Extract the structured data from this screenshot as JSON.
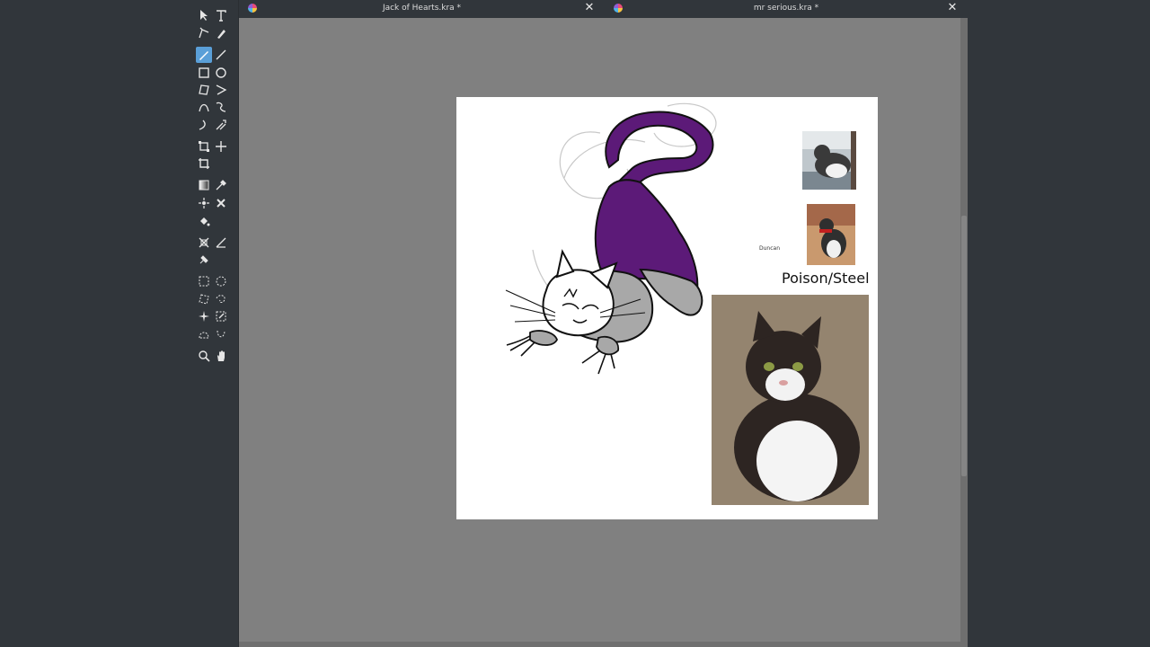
{
  "tabs": [
    {
      "title": "Jack of Hearts.kra *"
    },
    {
      "title": "mr serious.kra *"
    }
  ],
  "toolbox": {
    "tools": [
      {
        "name": "select-shapes-tool-icon",
        "col": 0,
        "row": 0
      },
      {
        "name": "text-tool-icon",
        "col": 1,
        "row": 0
      },
      {
        "name": "edit-shapes-tool-icon",
        "col": 0,
        "row": 1
      },
      {
        "name": "calligraphy-tool-icon",
        "col": 1,
        "row": 1
      },
      {
        "name": "freehand-brush-tool-icon",
        "col": 0,
        "row": 2,
        "active": true
      },
      {
        "name": "line-tool-icon",
        "col": 1,
        "row": 2
      },
      {
        "name": "rectangle-tool-icon",
        "col": 0,
        "row": 3
      },
      {
        "name": "ellipse-tool-icon",
        "col": 1,
        "row": 3
      },
      {
        "name": "polygon-tool-icon",
        "col": 0,
        "row": 4
      },
      {
        "name": "polyline-tool-icon",
        "col": 1,
        "row": 4
      },
      {
        "name": "bezier-curve-tool-icon",
        "col": 0,
        "row": 5
      },
      {
        "name": "freehand-path-tool-icon",
        "col": 1,
        "row": 5
      },
      {
        "name": "dynamic-brush-tool-icon",
        "col": 0,
        "row": 6
      },
      {
        "name": "multibrush-tool-icon",
        "col": 1,
        "row": 6
      },
      {
        "name": "transform-tool-icon",
        "col": 0,
        "row": 7
      },
      {
        "name": "move-tool-icon",
        "col": 1,
        "row": 7
      },
      {
        "name": "crop-tool-icon",
        "col": 0,
        "row": 8
      },
      {
        "name": "gradient-tool-icon",
        "col": 0,
        "row": 9
      },
      {
        "name": "color-picker-tool-icon",
        "col": 1,
        "row": 9
      },
      {
        "name": "colorize-mask-tool-icon",
        "col": 0,
        "row": 10
      },
      {
        "name": "smart-patch-tool-icon",
        "col": 1,
        "row": 10
      },
      {
        "name": "fill-tool-icon",
        "col": 0,
        "row": 11
      },
      {
        "name": "assistant-tool-icon",
        "col": 0,
        "row": 12
      },
      {
        "name": "measure-tool-icon",
        "col": 1,
        "row": 12
      },
      {
        "name": "reference-images-tool-icon",
        "col": 0,
        "row": 13
      },
      {
        "name": "rectangular-selection-tool-icon",
        "col": 0,
        "row": 14
      },
      {
        "name": "elliptical-selection-tool-icon",
        "col": 1,
        "row": 14
      },
      {
        "name": "polygonal-selection-tool-icon",
        "col": 0,
        "row": 15
      },
      {
        "name": "freehand-selection-tool-icon",
        "col": 1,
        "row": 15
      },
      {
        "name": "contiguous-selection-tool-icon",
        "col": 0,
        "row": 16
      },
      {
        "name": "similar-selection-tool-icon",
        "col": 1,
        "row": 16
      },
      {
        "name": "bezier-selection-tool-icon",
        "col": 0,
        "row": 17
      },
      {
        "name": "magnetic-selection-tool-icon",
        "col": 1,
        "row": 17
      },
      {
        "name": "zoom-tool-icon",
        "col": 0,
        "row": 18
      },
      {
        "name": "pan-tool-icon",
        "col": 1,
        "row": 18
      }
    ]
  },
  "canvas": {
    "reference_label": "Duncan",
    "type_label": "Poison/Steel",
    "colors": {
      "fur_purple": "#5c1a78",
      "fur_gray": "#a8a8a8",
      "page": "#ffffff",
      "canvas_bg": "#808080",
      "ui_dark": "#31363b"
    }
  }
}
